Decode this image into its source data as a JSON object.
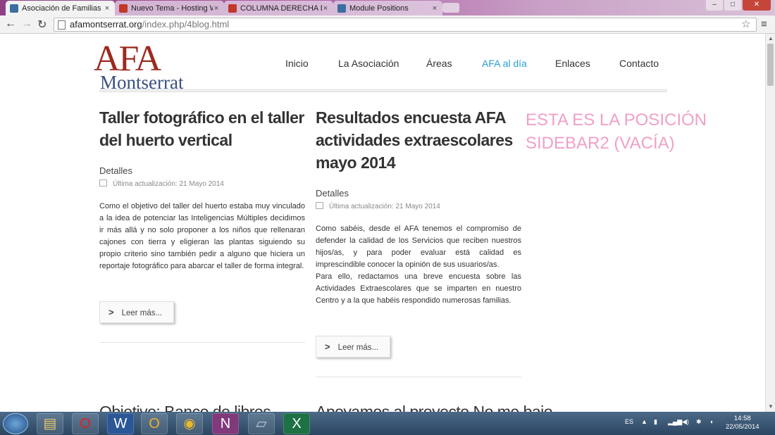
{
  "browser": {
    "tabs": [
      {
        "title": "Asociación de Familias de",
        "active": true,
        "favicon_color": "#3a6fa0"
      },
      {
        "title": "Nuevo Tema - Hosting W",
        "active": false,
        "favicon_color": "#c0392b"
      },
      {
        "title": "COLUMNA DERECHA DES",
        "active": false,
        "favicon_color": "#c0392b"
      },
      {
        "title": "Module Positions",
        "active": false,
        "favicon_color": "#3a6fa0"
      }
    ],
    "close_glyph": "×",
    "address": {
      "host": "afamontserrat.org",
      "path": "/index.php/4blog.html"
    }
  },
  "site": {
    "logo": {
      "line1": "AFA",
      "line2": "Montserrat"
    },
    "nav": [
      "Inicio",
      "La Asociación",
      "Áreas",
      "AFA al día",
      "Enlaces",
      "Contacto"
    ],
    "articles": [
      {
        "title": "Taller fotográfico en el taller del huerto vertical",
        "details": "Detalles",
        "updated": "Última actualización: 21 Mayo 2014",
        "body": "Como el objetivo del taller del huerto estaba muy vinculado a la idea de potenciar las Inteligencias Múltiples decidimos ir más allá y no solo proponer a los niños que rellenaran cajones con tierra y eligieran las plantas siguiendo su propio criterio sino también pedir a alguno que hiciera un reportaje fotográfico para abarcar el taller de forma integral.",
        "read_more": "Leer más..."
      },
      {
        "title": "Resultados encuesta AFA actividades extraescolares mayo 2014",
        "details": "Detalles",
        "updated": "Última actualización: 21 Mayo 2014",
        "body_p1": "Como sabéis, desde el AFA tenemos el compromiso de defender la calidad de los Servicios que reciben nuestros hijos/as, y para poder evaluar está calidad es imprescindible conocer la opinión de sus usuarios/as.",
        "body_p2": "Para ello, redactamos una breve encuesta sobre las Actividades Extraescolares que se imparten en nuestro Centro y a la que habéis respondido numerosas familias.",
        "read_more": "Leer más..."
      }
    ],
    "sidebar_text": "ESTA ES LA POSICIÓN SIDEBAR2 (VACÍA)",
    "next_titles": [
      "Objetivo: Banco de libros",
      "Apoyamos al proyecto No me bajo"
    ],
    "colors": {
      "link_active": "#2a9fd6",
      "sidebar_pink": "#f0a0c8",
      "logo_red": "#9c2a1f",
      "logo_blue": "#3b4f84"
    }
  },
  "taskbar": {
    "lang": "ES",
    "time": "14:58",
    "date": "22/05/2014",
    "apps": [
      "explorer-icon",
      "opera-icon",
      "word-icon",
      "outlook-icon",
      "chrome-icon",
      "onenote-icon",
      "notepad-icon",
      "excel-icon"
    ]
  }
}
